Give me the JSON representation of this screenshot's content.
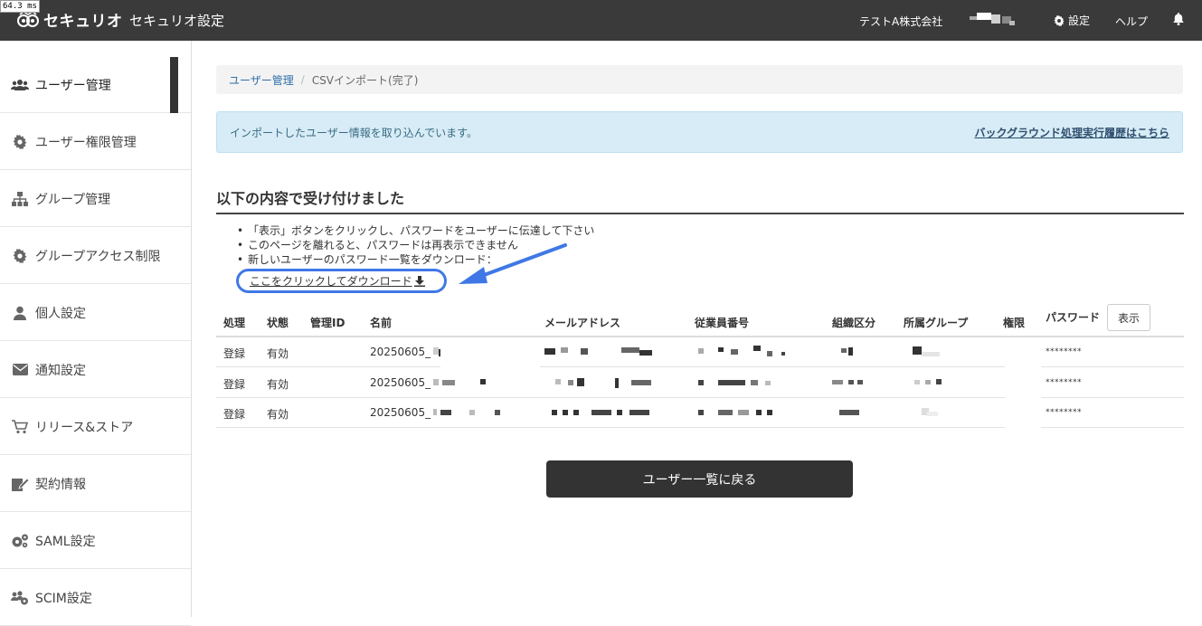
{
  "timing_badge": "64.3 ms",
  "header": {
    "logo_text": "セキュリオ",
    "app_title": "セキュリオ設定",
    "company": "テストA株式会社",
    "settings_label": "設定",
    "help_label": "ヘルプ"
  },
  "sidebar": {
    "items": [
      {
        "label": "ユーザー管理",
        "icon": "users-icon"
      },
      {
        "label": "ユーザー権限管理",
        "icon": "gear-icon"
      },
      {
        "label": "グループ管理",
        "icon": "sitemap-icon"
      },
      {
        "label": "グループアクセス制限",
        "icon": "gear-icon"
      },
      {
        "label": "個人設定",
        "icon": "user-icon"
      },
      {
        "label": "通知設定",
        "icon": "envelope-icon"
      },
      {
        "label": "リリース&ストア",
        "icon": "cart-icon"
      },
      {
        "label": "契約情報",
        "icon": "signature-icon"
      },
      {
        "label": "SAML設定",
        "icon": "gears-icon"
      },
      {
        "label": "SCIM設定",
        "icon": "users-gear-icon"
      }
    ]
  },
  "breadcrumb": {
    "parent": "ユーザー管理",
    "separator": "/",
    "current": "CSVインポート(完了)"
  },
  "alert": {
    "message": "インポートしたユーザー情報を取り込んでいます。",
    "link": "バックグラウンド処理実行履歴はこちら"
  },
  "section": {
    "title": "以下の内容で受け付けました",
    "notes": [
      "「表示」ボタンをクリックし、パスワードをユーザーに伝達して下さい",
      "このページを離れると、パスワードは再表示できません",
      "新しいユーザーのパスワード一覧をダウンロード："
    ],
    "download_link": "ここをクリックしてダウンロード"
  },
  "table": {
    "headers": [
      "処理",
      "状態",
      "管理ID",
      "名前",
      "メールアドレス",
      "従業員番号",
      "組織区分",
      "所属グループ",
      "権限",
      "パスワード"
    ],
    "show_button": "表示",
    "rows": [
      {
        "action": "登録",
        "status": "有効",
        "name": "20250605_",
        "password": "********"
      },
      {
        "action": "登録",
        "status": "有効",
        "name": "20250605_",
        "password": "********"
      },
      {
        "action": "登録",
        "status": "有効",
        "name": "20250605_",
        "password": "********"
      }
    ]
  },
  "back_button": "ユーザー一覧に戻る",
  "colors": {
    "header_bg": "#3a3a3a",
    "alert_bg": "#d7ecf6",
    "highlight": "#3f78e6",
    "link": "#2f6fa8"
  }
}
